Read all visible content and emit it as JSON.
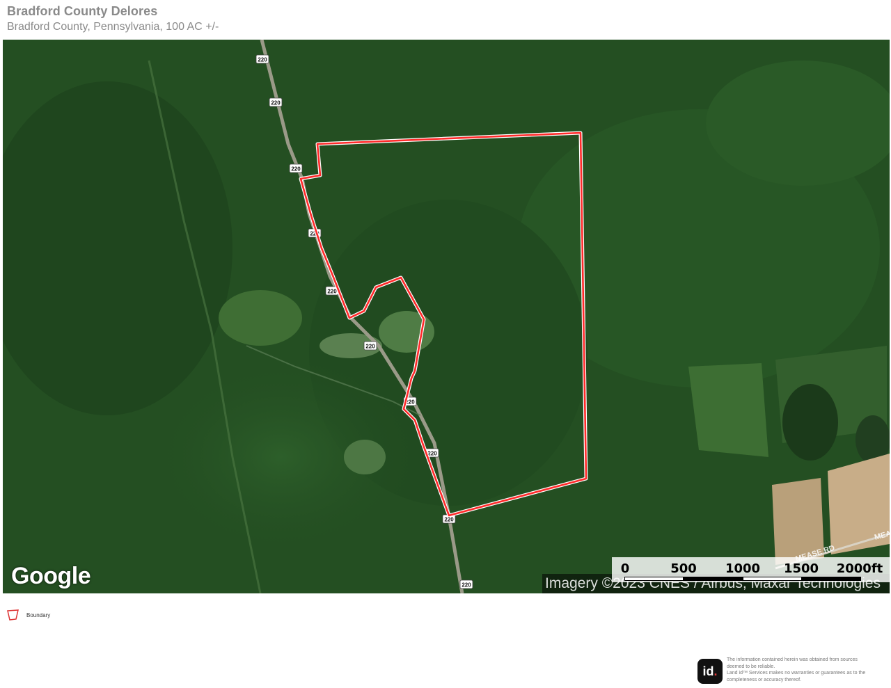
{
  "header": {
    "title": "Bradford County Delores",
    "subtitle": "Bradford County, Pennsylvania, 100 AC +/-"
  },
  "map": {
    "provider_logo": "Google",
    "imagery_credit": "Imagery ©2023 CNES / Airbus, Maxar Technologies",
    "road_shield": "220",
    "road_labels": [
      "MEASE RD",
      "MEA"
    ],
    "boundary_color": "#ff2a2a",
    "scale": {
      "labels": [
        "0",
        "500",
        "1000",
        "1500",
        "2000ft"
      ]
    }
  },
  "legend": {
    "items": [
      {
        "label": "Boundary",
        "icon": "boundary-polygon-icon"
      }
    ]
  },
  "footer": {
    "logo_text": "id",
    "disclaimer_lines": [
      "The information contained herein was obtained from sources",
      "deemed to be reliable.",
      "Land id™ Services makes no warranties or guarantees as to the",
      "completeness or accuracy thereof."
    ]
  }
}
